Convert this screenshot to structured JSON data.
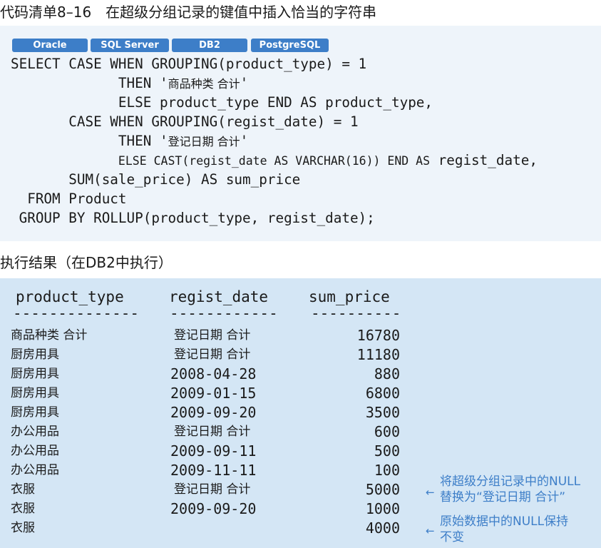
{
  "heading1": "代码清单8–16　在超级分组记录的键值中插入恰当的字符串",
  "heading2": "执行结果（在DB2中执行）",
  "db_tags": [
    "Oracle",
    "SQL Server",
    "DB2",
    "PostgreSQL"
  ],
  "code": {
    "l1": "SELECT CASE WHEN GROUPING(product_type) = 1",
    "l2a": "             THEN '",
    "l2b": "商品种类 合计",
    "l2c": "'",
    "l3": "             ELSE product_type END AS product_type,",
    "l4": "       CASE WHEN GROUPING(regist_date) = 1",
    "l5a": "             THEN '",
    "l5b": "登记日期 合计",
    "l5c": "'",
    "l6a": "             ",
    "l6b": "ELSE CAST(regist_date AS VARCHAR(16)) END AS",
    "l6c": " regist_date,",
    "l7": "       SUM(sale_price) AS sum_price",
    "l8": "  FROM Product",
    "l9": " GROUP BY ROLLUP(product_type, regist_date);"
  },
  "result": {
    "headers": [
      "product_type",
      "regist_date",
      "sum_price"
    ],
    "dashes": [
      "--------------",
      "------------",
      "----------"
    ],
    "rows": [
      [
        "商品种类 合计",
        "登记日期 合计",
        "16780"
      ],
      [
        "厨房用具",
        "登记日期 合计",
        "11180"
      ],
      [
        "厨房用具",
        "2008-04-28",
        "880"
      ],
      [
        "厨房用具",
        "2009-01-15",
        "6800"
      ],
      [
        "厨房用具",
        "2009-09-20",
        "3500"
      ],
      [
        "办公用品",
        "登记日期 合计",
        "600"
      ],
      [
        "办公用品",
        "2009-09-11",
        "500"
      ],
      [
        "办公用品",
        "2009-11-11",
        "100"
      ],
      [
        "衣服",
        "登记日期 合计",
        "5000"
      ],
      [
        "衣服",
        "2009-09-20",
        "1000"
      ],
      [
        "衣服",
        "",
        "4000"
      ]
    ]
  },
  "notes": {
    "n1_line1": "将超级分组记录中的NULL",
    "n1_line2": "替换为“登记日期 合计”",
    "n2_line1": "原始数据中的NULL保持",
    "n2_line2": "不变",
    "arrow": "←"
  },
  "colors": {
    "accent": "#3d7ec8",
    "code_bg": "#eef4fa",
    "result_bg": "#d4e6f5"
  }
}
